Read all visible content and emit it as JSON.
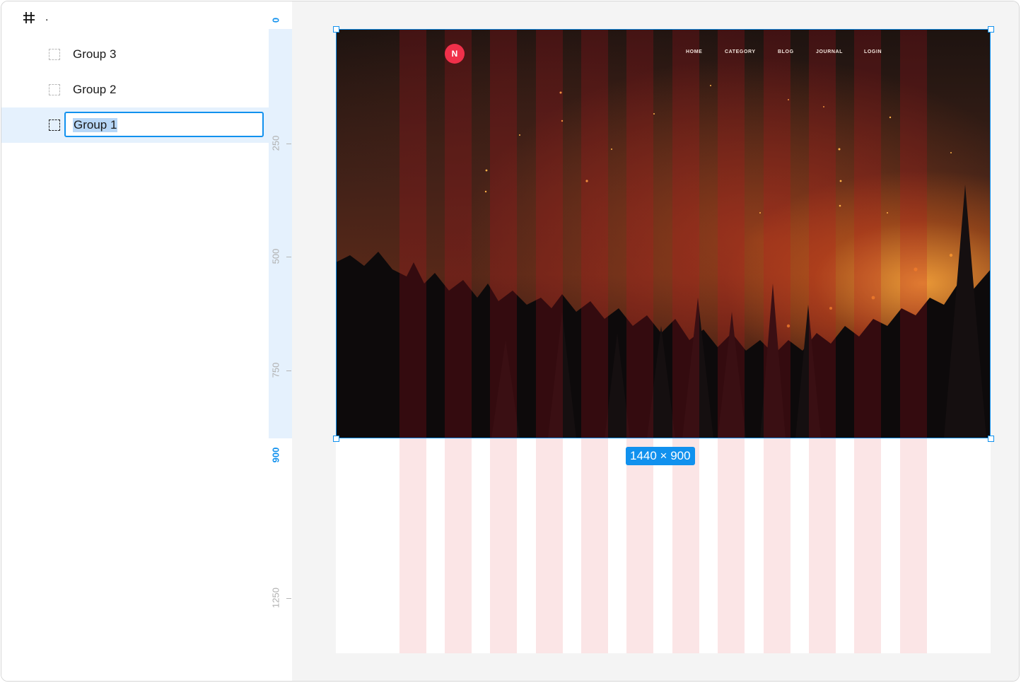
{
  "layers_panel": {
    "frame_name": ".",
    "items": [
      {
        "label": "Group 3"
      },
      {
        "label": "Group 2"
      },
      {
        "label": "Group 1",
        "selected": true,
        "editing": true
      }
    ]
  },
  "ruler": {
    "labels": [
      "0",
      "250",
      "500",
      "750",
      "900",
      "1250"
    ],
    "active": [
      "0",
      "900"
    ]
  },
  "canvas": {
    "selection_size": "1440 × 900",
    "accent_color": "#1191ee",
    "grid_color": "#f7c9cc",
    "site": {
      "logo_letter": "N",
      "logo_color": "#f0304a",
      "nav": [
        "HOME",
        "CATEGORY",
        "BLOG",
        "JOURNAL",
        "LOGIN"
      ]
    }
  }
}
